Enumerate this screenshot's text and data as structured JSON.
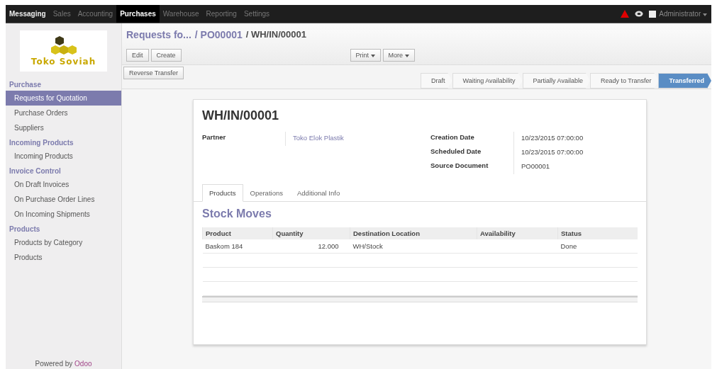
{
  "top_menu": [
    {
      "label": "Messaging",
      "kind": "primary",
      "selected": false
    },
    {
      "label": "Sales",
      "kind": "app",
      "selected": false
    },
    {
      "label": "Accounting",
      "kind": "app",
      "selected": false
    },
    {
      "label": "Purchases",
      "kind": "app",
      "selected": true
    },
    {
      "label": "Warehouse",
      "kind": "app",
      "selected": false
    },
    {
      "label": "Reporting",
      "kind": "app",
      "selected": false
    },
    {
      "label": "Settings",
      "kind": "app",
      "selected": false
    }
  ],
  "user": {
    "name": "Administrator"
  },
  "logo": {
    "name": "Toko Soviah"
  },
  "sidebar": {
    "sections": [
      {
        "title": "Purchase",
        "items": [
          {
            "label": "Requests for Quotation",
            "selected": true
          },
          {
            "label": "Purchase Orders",
            "selected": false
          },
          {
            "label": "Suppliers",
            "selected": false
          }
        ]
      },
      {
        "title": "Incoming Products",
        "items": [
          {
            "label": "Incoming Products",
            "selected": false
          }
        ]
      },
      {
        "title": "Invoice Control",
        "items": [
          {
            "label": "On Draft Invoices",
            "selected": false
          },
          {
            "label": "On Purchase Order Lines",
            "selected": false
          },
          {
            "label": "On Incoming Shipments",
            "selected": false
          }
        ]
      },
      {
        "title": "Products",
        "items": [
          {
            "label": "Products by Category",
            "selected": false
          },
          {
            "label": "Products",
            "selected": false
          }
        ]
      }
    ],
    "footer": {
      "text": "Powered by",
      "link": "Odoo"
    }
  },
  "breadcrumb": [
    {
      "label": "Requests fo...",
      "kind": "link"
    },
    {
      "label": "/ PO00001",
      "kind": "link"
    },
    {
      "label": "/ WH/IN/00001",
      "kind": "current"
    }
  ],
  "left_buttons": [
    "Edit",
    "Create"
  ],
  "menu_buttons": [
    "Print",
    "More"
  ],
  "action_buttons": [
    "Reverse Transfer"
  ],
  "stages": [
    {
      "label": "Draft",
      "selected": false
    },
    {
      "label": "Waiting Availability",
      "selected": false
    },
    {
      "label": "Partially Available",
      "selected": false
    },
    {
      "label": "Ready to Transfer",
      "selected": false
    },
    {
      "label": "Transferred",
      "selected": true
    }
  ],
  "sheet": {
    "title": "WH/IN/00001",
    "left_fields": [
      {
        "label": "Partner",
        "value": "Toko Elok Plastik",
        "kind": "link"
      }
    ],
    "right_fields": [
      {
        "label": "Creation Date",
        "value": "10/23/2015 07:00:00"
      },
      {
        "label": "Scheduled Date",
        "value": "10/23/2015 07:00:00"
      },
      {
        "label": "Source Document",
        "value": "PO00001"
      }
    ],
    "tabs": [
      {
        "label": "Products",
        "selected": true
      },
      {
        "label": "Operations",
        "selected": false
      },
      {
        "label": "Additional Info",
        "selected": false
      }
    ],
    "section_title": "Stock Moves",
    "table": {
      "columns": [
        "Product",
        "Quantity",
        "Destination Location",
        "Availability",
        "Status"
      ],
      "rows": [
        [
          "Baskom 184",
          "12.000",
          "WH/Stock",
          "",
          "Done"
        ]
      ]
    }
  }
}
